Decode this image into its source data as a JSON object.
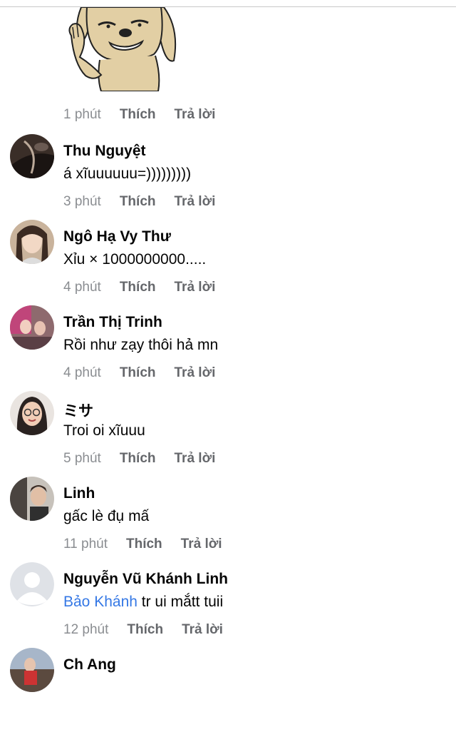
{
  "sticker_post": {
    "time": "1 phút",
    "like_label": "Thích",
    "reply_label": "Trả lời"
  },
  "comments": [
    {
      "name": "Thu Nguyệt",
      "text": "á xĩuuuuuu=)))))))))",
      "time": "3 phút",
      "like": "Thích",
      "reply": "Trả lời",
      "avatar": "dark-photo"
    },
    {
      "name": "Ngô Hạ Vy Thư",
      "text": "Xỉu × 1000000000.....",
      "time": "4 phút",
      "like": "Thích",
      "reply": "Trả lời",
      "avatar": "girl-photo"
    },
    {
      "name": "Trần Thị Trinh",
      "text": "Rồi như zạy thôi hả mn",
      "time": "4 phút",
      "like": "Thích",
      "reply": "Trả lời",
      "avatar": "group-photo"
    },
    {
      "name": "ミサ",
      "text": "Troi oi xĩuuu",
      "time": "5 phút",
      "like": "Thích",
      "reply": "Trả lời",
      "avatar": "glasses-girl-photo"
    },
    {
      "name": "Linh",
      "text": "gấc lè đụ mấ",
      "time": "11 phút",
      "like": "Thích",
      "reply": "Trả lời",
      "avatar": "boy-photo"
    },
    {
      "name": "Nguyễn Vũ Khánh Linh",
      "mention": "Bảo Khánh",
      "text": " tr ui mắtt tuii",
      "time": "12 phút",
      "like": "Thích",
      "reply": "Trả lời",
      "avatar": "default-avatar"
    },
    {
      "name": "Ch Ang",
      "text": "",
      "time": "",
      "like": "",
      "reply": "",
      "avatar": "outdoor-photo"
    }
  ],
  "colors": {
    "meta_gray": "#8a8d91",
    "action_gray": "#65676b",
    "mention_blue": "#3578e5"
  }
}
